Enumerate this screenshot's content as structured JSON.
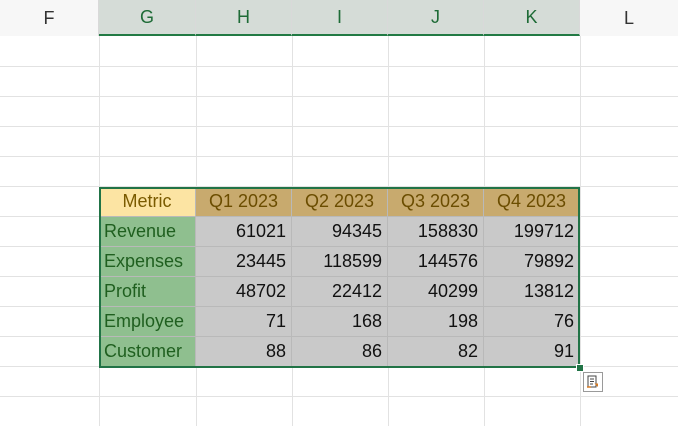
{
  "columns": [
    "F",
    "G",
    "H",
    "I",
    "J",
    "K",
    "L"
  ],
  "selected_columns": [
    "G",
    "H",
    "I",
    "J",
    "K"
  ],
  "table": {
    "headers": [
      "Metric",
      "Q1 2023",
      "Q2 2023",
      "Q3 2023",
      "Q4 2023"
    ],
    "rows": [
      {
        "label": "Revenue",
        "values": [
          "61021",
          "94345",
          "158830",
          "199712"
        ]
      },
      {
        "label": "Expenses",
        "values": [
          "23445",
          "118599",
          "144576",
          "79892"
        ]
      },
      {
        "label": "Profit",
        "values": [
          "48702",
          "22412",
          "40299",
          "13812"
        ]
      },
      {
        "label": "Employee",
        "values": [
          "71",
          "168",
          "198",
          "76"
        ]
      },
      {
        "label": "Customer",
        "values": [
          "88",
          "86",
          "82",
          "91"
        ]
      }
    ]
  },
  "icons": {
    "quick_analysis": "quick-analysis-icon"
  },
  "colors": {
    "metric_header": "#fce4a3",
    "quarter_header": "#c8aa6e",
    "row_label": "#8fbf8f",
    "value_cell": "#c9c9c9",
    "selection": "#217346"
  }
}
